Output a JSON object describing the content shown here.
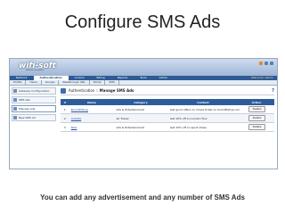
{
  "slide": {
    "title": "Configure SMS Ads",
    "caption": "You can add any advertisement and any number of SMS Ads"
  },
  "app": {
    "logo_text": "wifi-soft",
    "logo_sub": "wireless everywhere",
    "menu": [
      "Network",
      "Authentication",
      "Control",
      "Billing",
      "Reports",
      "Tools",
      "Admin"
    ],
    "active_menu": "Authentication",
    "welcome": "Welcome: admin",
    "submenu": [
      "Profile",
      "Users",
      "Groups",
      "Passthrough URL",
      "Portal",
      "SMS"
    ],
    "sidebar": [
      "Gateway Configuration",
      "SMS Ads",
      "Manage Ads",
      "New SMS Ad"
    ],
    "page_title_prefix": "Authentication",
    "page_title_sep": "::",
    "page_title": "Manage SMS Ads",
    "help": "?",
    "table": {
      "headers": [
        "#",
        "Name",
        "Category",
        "Content",
        "Action"
      ],
      "rows": [
        {
          "num": "1",
          "name": "BoomfitShop",
          "category": "Ads & Entertainment",
          "content": "Get good offers on movie ticket on boomfitshop.com",
          "action": "Delete"
        },
        {
          "num": "2",
          "name": "Gobbbs",
          "category": "Air Travel",
          "content": "Get 10% off on London Tour",
          "action": "Delete"
        },
        {
          "num": "3",
          "name": "Nike",
          "category": "Ads & Entertainment",
          "content": "Get 10% off on sport shoes",
          "action": "Delete"
        }
      ]
    }
  },
  "colors": {
    "header_blue": "#2e5c9b",
    "menu_blue": "#2f5b95",
    "link": "#1f4fa6"
  }
}
